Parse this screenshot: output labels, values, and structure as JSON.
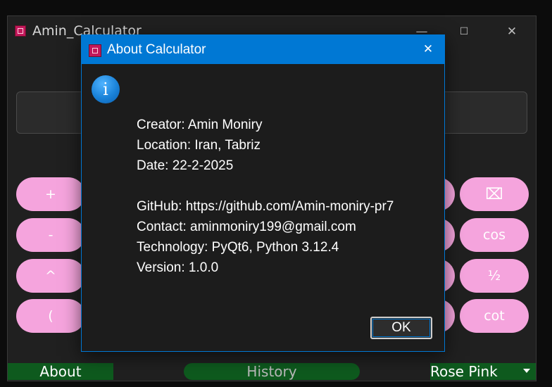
{
  "main_window": {
    "title": "Amin_Calculator",
    "controls": {
      "minimize": "—",
      "maximize": "☐",
      "close": "✕"
    }
  },
  "left_buttons": [
    "+",
    "-",
    "^",
    "("
  ],
  "right_buttons": [
    "⌧",
    "cos",
    "½",
    "cot"
  ],
  "bottom_bar": {
    "about_label": "About",
    "history_label": "History",
    "theme_label": "Rose Pink"
  },
  "dialog": {
    "title": "About Calculator",
    "close": "✕",
    "info_icon_glyph": "i",
    "lines": {
      "creator": "Creator: Amin Moniry",
      "location": "Location: Iran, Tabriz",
      "date": "Date: 22-2-2025",
      "github": "GitHub: https://github.com/Amin-moniry-pr7",
      "contact": "Contact: aminmoniry199@gmail.com",
      "technology": "Technology: PyQt6, Python 3.12.4",
      "version": "Version: 1.0.0"
    },
    "ok_label": "OK"
  },
  "colors": {
    "accent": "#0078d4",
    "button_pink": "#f5a4dd",
    "bottom_green": "#0e5a1e"
  }
}
